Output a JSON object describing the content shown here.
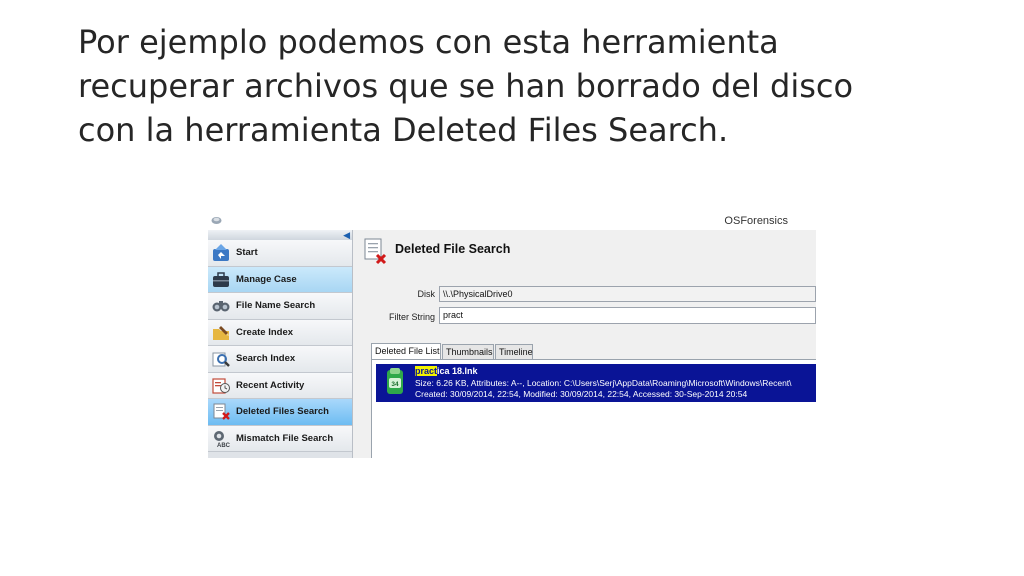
{
  "slide": {
    "title_lines": [
      "Por ejemplo podemos con esta herramienta",
      "recuperar archivos que se han borrado del disco",
      "con la herramienta Deleted Files Search."
    ]
  },
  "app": {
    "window_title": "OSForensics",
    "sidebar": {
      "items": [
        {
          "label": "Start",
          "icon": "start-icon"
        },
        {
          "label": "Manage Case",
          "icon": "briefcase-icon"
        },
        {
          "label": "File Name Search",
          "icon": "binoculars-icon"
        },
        {
          "label": "Create Index",
          "icon": "create-index-icon"
        },
        {
          "label": "Search Index",
          "icon": "search-index-icon"
        },
        {
          "label": "Recent Activity",
          "icon": "recent-activity-icon"
        },
        {
          "label": "Deleted Files Search",
          "icon": "deleted-file-icon"
        },
        {
          "label": "Mismatch File Search",
          "icon": "mismatch-icon"
        }
      ],
      "active_index": 6,
      "highlight_index": 1
    },
    "panel": {
      "title": "Deleted File Search",
      "disk_label": "Disk",
      "disk_value": "\\\\.\\PhysicalDrive0",
      "filter_label": "Filter String",
      "filter_value": "pract",
      "tabs": [
        "Deleted File List",
        "Thumbnails",
        "Timeline"
      ],
      "selected_tab": 0,
      "results": [
        {
          "name_match": "pract",
          "name_rest": "ica 18.lnk",
          "icon_badge": "34",
          "details": "Size: 6.26 KB, Attributes: A--, Location: C:\\Users\\Serj\\AppData\\Roaming\\Microsoft\\Windows\\Recent\\",
          "dates": "Created: 30/09/2014, 22:54, Modified: 30/09/2014, 22:54, Accessed: 30-Sep-2014 20:54"
        }
      ]
    },
    "colors": {
      "selection": "#0a1496",
      "match_highlight": "#f2f200",
      "active_nav": "#6dbcf2"
    }
  }
}
